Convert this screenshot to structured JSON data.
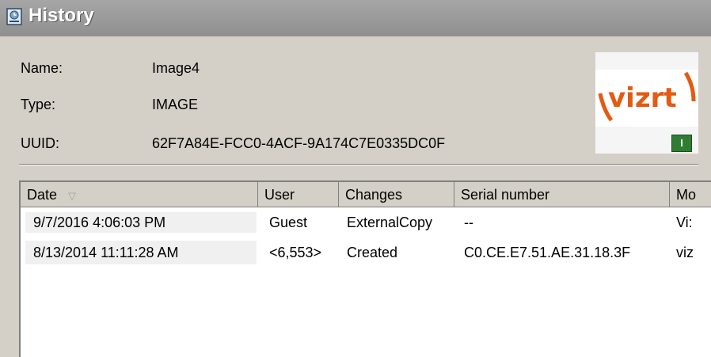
{
  "window": {
    "title": "History",
    "icon": "history-icon"
  },
  "info": {
    "name_label": "Name:",
    "name_value": "Image4",
    "type_label": "Type:",
    "type_value": "IMAGE",
    "uuid_label": "UUID:",
    "uuid_value": "62F7A84E-FCC0-4ACF-9A174C7E0335DC0F"
  },
  "thumbnail": {
    "logo_text": "vizrt",
    "badge_text": "I",
    "logo_color": "#e35a12",
    "badge_color": "#2f7d32"
  },
  "table": {
    "columns": [
      "Date",
      "User",
      "Changes",
      "Serial number",
      "Mo"
    ],
    "sort_column": "Date",
    "rows": [
      [
        "9/7/2016 4:06:03 PM",
        "Guest",
        "ExternalCopy",
        "--",
        "Vi:"
      ],
      [
        "8/13/2014 11:11:28 AM",
        "<6,553>",
        "Created",
        "C0.CE.E7.51.AE.31.18.3F",
        "viz"
      ]
    ]
  }
}
